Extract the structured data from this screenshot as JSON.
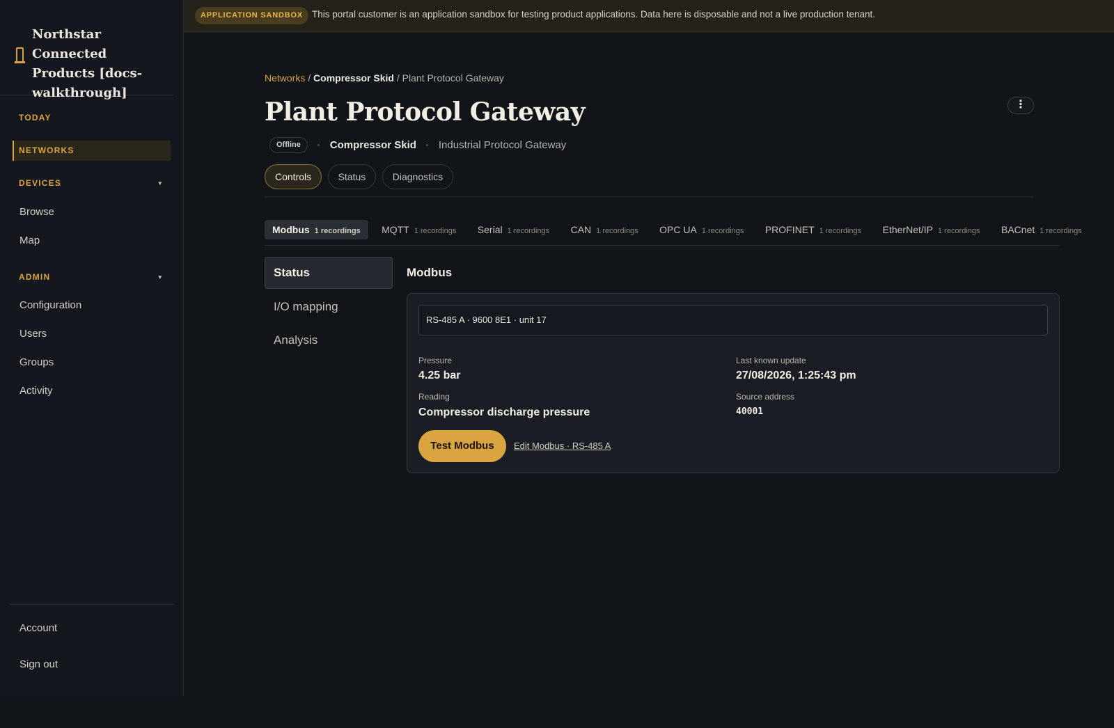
{
  "banner": {
    "badge": "APPLICATION SANDBOX",
    "text": "This portal customer is an application sandbox for testing product applications. Data here is disposable and not a live production tenant."
  },
  "sidebar": {
    "brand": "Northstar Connected Products [docs-walkthrough]",
    "brand_icon": "tower-icon",
    "sections": {
      "today": "TODAY",
      "networks": "NETWORKS",
      "devices": "DEVICES",
      "admin": "ADMIN"
    },
    "devices_items": [
      "Browse",
      "Map"
    ],
    "admin_items": [
      "Configuration",
      "Users",
      "Groups",
      "Activity"
    ],
    "footer_items": [
      "Account",
      "Sign out"
    ]
  },
  "breadcrumb": {
    "networks": "Networks",
    "sep": "/",
    "device": "Compressor Skid",
    "current": "Plant Protocol Gateway"
  },
  "page": {
    "title": "Plant Protocol Gateway",
    "status": "Offline",
    "device": "Compressor Skid",
    "type": "Industrial Protocol Gateway",
    "kebab": "⋮"
  },
  "tabs": [
    "Controls",
    "Status",
    "Diagnostics"
  ],
  "protocols": [
    {
      "name": "Modbus",
      "count": "1 recordings"
    },
    {
      "name": "MQTT",
      "count": "1 recordings"
    },
    {
      "name": "Serial",
      "count": "1 recordings"
    },
    {
      "name": "CAN",
      "count": "1 recordings"
    },
    {
      "name": "OPC UA",
      "count": "1 recordings"
    },
    {
      "name": "PROFINET",
      "count": "1 recordings"
    },
    {
      "name": "EtherNet/IP",
      "count": "1 recordings"
    },
    {
      "name": "BACnet",
      "count": "1 recordings"
    }
  ],
  "subnav": [
    "Status",
    "I/O mapping",
    "Analysis"
  ],
  "panel": {
    "title": "Modbus",
    "config": "RS-485 A · 9600 8E1 · unit 17",
    "pressure_label": "Pressure",
    "pressure_value": "4.25 bar",
    "reading_label": "Reading",
    "reading_value": "Compressor discharge pressure",
    "update_label": "Last known update",
    "update_value": "27/08/2026, 1:25:43 pm",
    "address_label": "Source address",
    "address_value": "40001",
    "test_button": "Test Modbus",
    "edit_link": "Edit Modbus · RS-485 A"
  },
  "colors": {
    "accent": "#d9a441",
    "background": "#111418",
    "sidebar": "#14181e"
  }
}
